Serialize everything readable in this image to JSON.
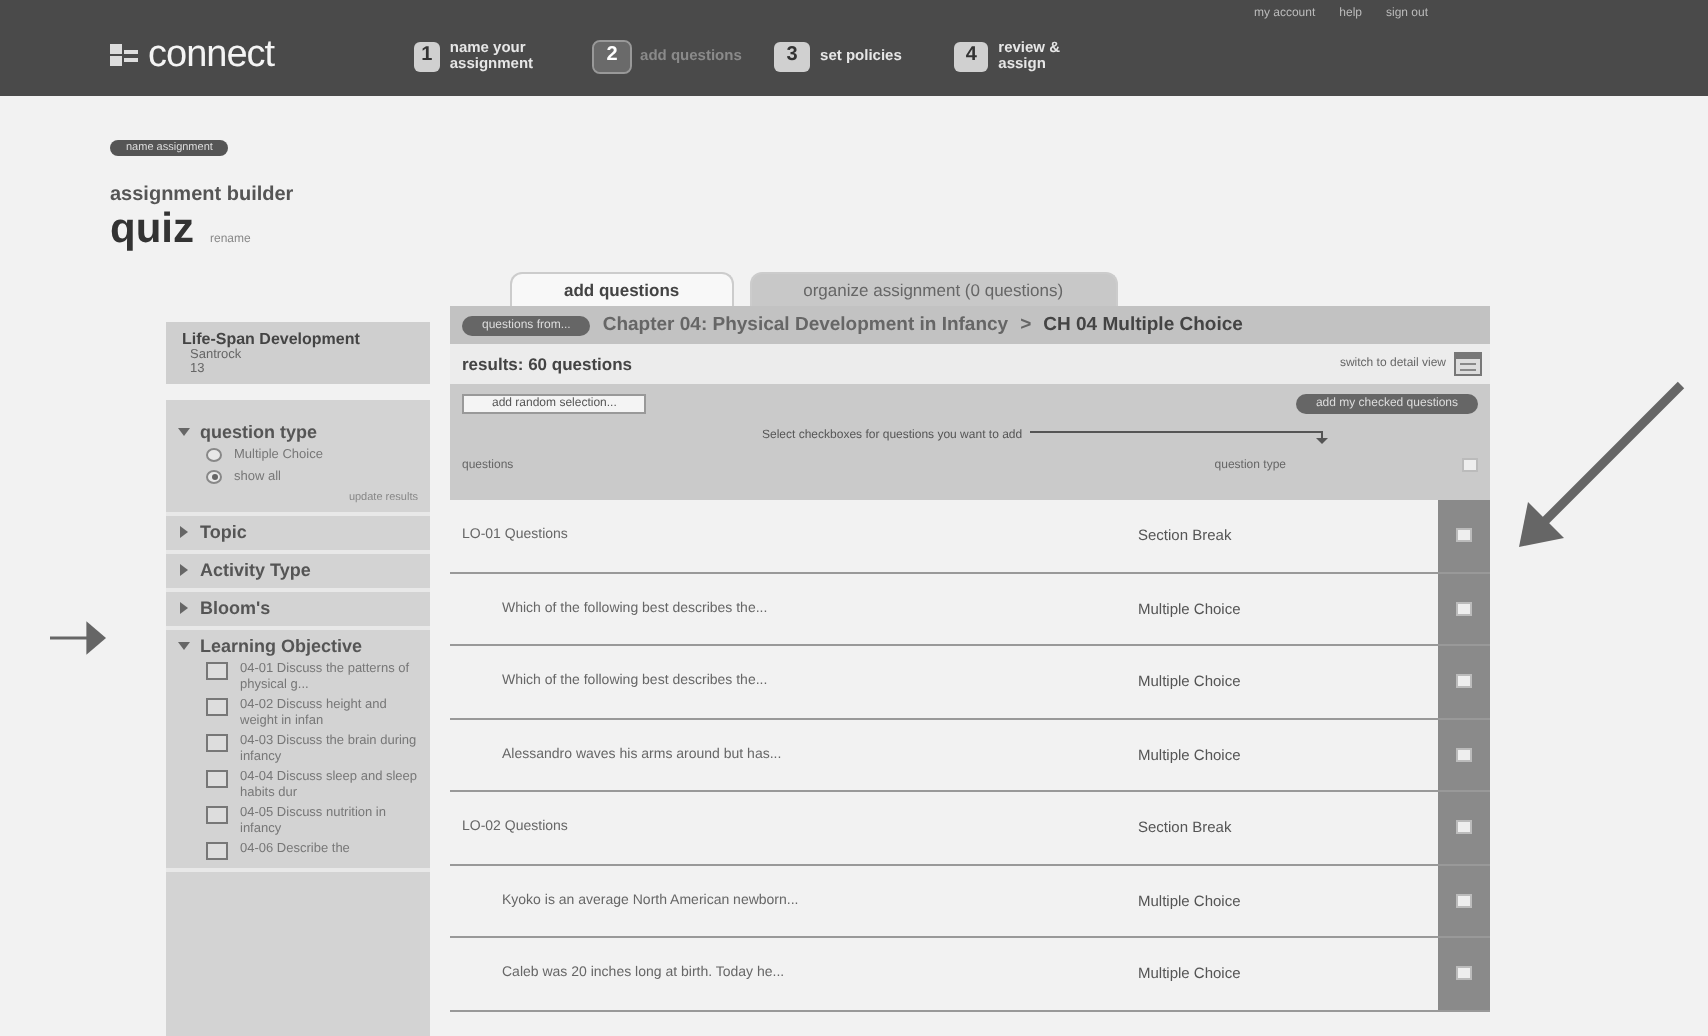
{
  "top_links": [
    "my account",
    "help",
    "sign out"
  ],
  "logo": "connect",
  "steps": [
    {
      "number": "1",
      "label": "name your assignment",
      "selected": false
    },
    {
      "number": "2",
      "label": "add questions",
      "selected": true
    },
    {
      "number": "3",
      "label": "set policies",
      "selected": false
    },
    {
      "number": "4",
      "label": "review & assign",
      "selected": false
    }
  ],
  "badge": "name assignment",
  "builder_label": "assignment builder",
  "assignment_name": "quiz",
  "rename_link": "rename",
  "book": {
    "title": "Life-Span Development",
    "author": "Santrock",
    "edition": "13"
  },
  "filters": [
    {
      "label": "question type",
      "expanded": true,
      "kind": "radio",
      "options": [
        {
          "label": "Multiple Choice",
          "selected": false
        },
        {
          "label": "show all",
          "selected": true
        }
      ],
      "action": "update results"
    },
    {
      "label": "Topic",
      "expanded": false
    },
    {
      "label": "Activity Type",
      "expanded": false
    },
    {
      "label": "Bloom's",
      "expanded": false
    },
    {
      "label": "Learning Objective",
      "expanded": true,
      "kind": "checkbox",
      "options": [
        {
          "label": "04-01 Discuss the patterns of physical g...",
          "checked": false
        },
        {
          "label": "04-02 Discuss height and weight in infan",
          "checked": false
        },
        {
          "label": "04-03 Discuss the brain during infancy",
          "checked": false
        },
        {
          "label": "04-04 Discuss sleep and sleep habits dur",
          "checked": false
        },
        {
          "label": "04-05 Discuss nutrition in infancy",
          "checked": false
        },
        {
          "label": "04-06 Describe the",
          "checked": false
        }
      ]
    }
  ],
  "tabs": [
    {
      "label": "add questions",
      "selected": true
    },
    {
      "label": "organize assignment (0 questions)",
      "selected": false
    }
  ],
  "source_button": "questions from...",
  "breadcrumb": {
    "chapter": "Chapter 04: Physical Development in Infancy",
    "separator": ">",
    "section": "CH 04 Multiple Choice"
  },
  "results": "results: 60 questions",
  "detail_view_link": "switch to detail view",
  "random_button": "add random selection...",
  "add_checked_button": "add my checked questions",
  "hint": "Select checkboxes for questions you want to add",
  "columns": [
    "questions",
    "question type"
  ],
  "header_checked": false,
  "rows": [
    {
      "kind": "section",
      "text": "LO-01 Questions",
      "type": "Section Break",
      "checked": false
    },
    {
      "kind": "question",
      "text": "Which of the following best describes the...",
      "type": "Multiple Choice",
      "checked": false
    },
    {
      "kind": "question",
      "text": "Which of the following best describes the...",
      "type": "Multiple Choice",
      "checked": false
    },
    {
      "kind": "question",
      "text": "Alessandro waves his arms around but has...",
      "type": "Multiple Choice",
      "checked": false
    },
    {
      "kind": "section",
      "text": "LO-02 Questions",
      "type": "Section Break",
      "checked": false
    },
    {
      "kind": "question",
      "text": "Kyoko is an average North American newborn...",
      "type": "Multiple Choice",
      "checked": false
    },
    {
      "kind": "question",
      "text": "Caleb was 20 inches long at birth. Today he...",
      "type": "Multiple Choice",
      "checked": false
    }
  ]
}
